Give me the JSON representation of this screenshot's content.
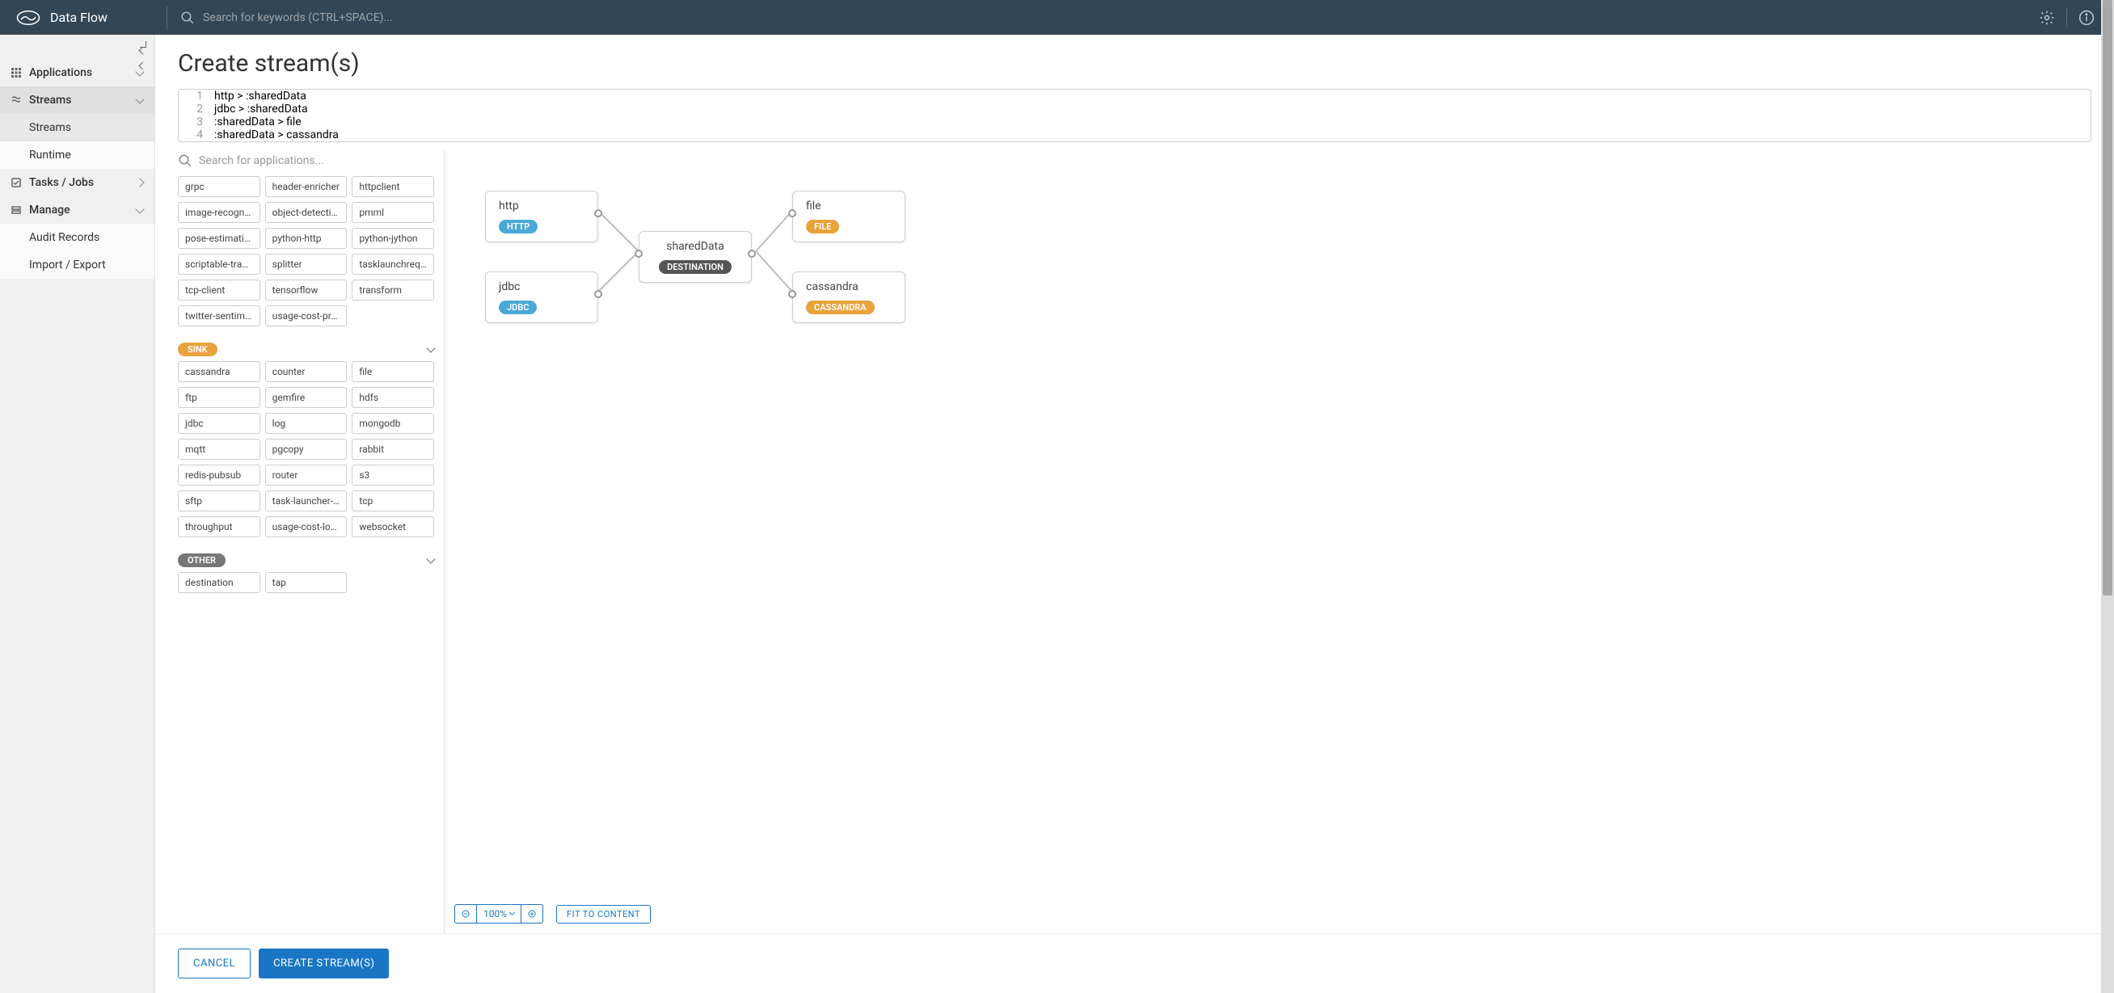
{
  "brand": "Data Flow",
  "topbar": {
    "search_placeholder": "Search for keywords (CTRL+SPACE)..."
  },
  "sidebar": {
    "items": [
      {
        "label": "Applications",
        "icon": "grid-icon",
        "type": "parent",
        "expand": false
      },
      {
        "label": "Streams",
        "icon": "stream-icon",
        "type": "parent",
        "expand": true,
        "selected": true,
        "children": [
          {
            "label": "Streams",
            "selected": true
          },
          {
            "label": "Runtime",
            "selected": false
          }
        ]
      },
      {
        "label": "Tasks / Jobs",
        "icon": "tasks-icon",
        "type": "parent",
        "expand": false,
        "chev": "right"
      },
      {
        "label": "Manage",
        "icon": "manage-icon",
        "type": "parent",
        "expand": true,
        "children": [
          {
            "label": "Audit Records"
          },
          {
            "label": "Import / Export"
          }
        ]
      }
    ]
  },
  "page": {
    "title": "Create stream(s)"
  },
  "code": {
    "lines": [
      "http > :sharedData",
      "jdbc > :sharedData",
      ":sharedData > file",
      ":sharedData > cassandra"
    ]
  },
  "palette": {
    "search_placeholder": "Search for applications...",
    "processor_items": [
      "grpc",
      "header-enricher",
      "httpclient",
      "image-recogniti…",
      "object-detection",
      "pmml",
      "pose-estimation",
      "python-http",
      "python-jython",
      "scriptable-transf…",
      "splitter",
      "tasklaunchreque…",
      "tcp-client",
      "tensorflow",
      "transform",
      "twitter-sentiment",
      "usage-cost-proc…"
    ],
    "sink_label": "SINK",
    "sink_items": [
      "cassandra",
      "counter",
      "file",
      "ftp",
      "gemfire",
      "hdfs",
      "jdbc",
      "log",
      "mongodb",
      "mqtt",
      "pgcopy",
      "rabbit",
      "redis-pubsub",
      "router",
      "s3",
      "sftp",
      "task-launcher-d…",
      "tcp",
      "throughput",
      "usage-cost-logg…",
      "websocket"
    ],
    "other_label": "OTHER",
    "other_items": [
      "destination",
      "tap"
    ]
  },
  "canvas": {
    "nodes": {
      "http": {
        "title": "http",
        "pill": "HTTP",
        "pillClass": "http"
      },
      "jdbc": {
        "title": "jdbc",
        "pill": "JDBC",
        "pillClass": "jdbc"
      },
      "shared": {
        "title": "sharedData",
        "pill": "DESTINATION",
        "pillClass": "dest"
      },
      "file": {
        "title": "file",
        "pill": "FILE",
        "pillClass": "file"
      },
      "cass": {
        "title": "cassandra",
        "pill": "CASSANDRA",
        "pillClass": "cassandra"
      }
    },
    "zoom_label": "100%",
    "fit_label": "FIT TO CONTENT"
  },
  "footer": {
    "cancel": "CANCEL",
    "create": "CREATE STREAM(S)"
  }
}
